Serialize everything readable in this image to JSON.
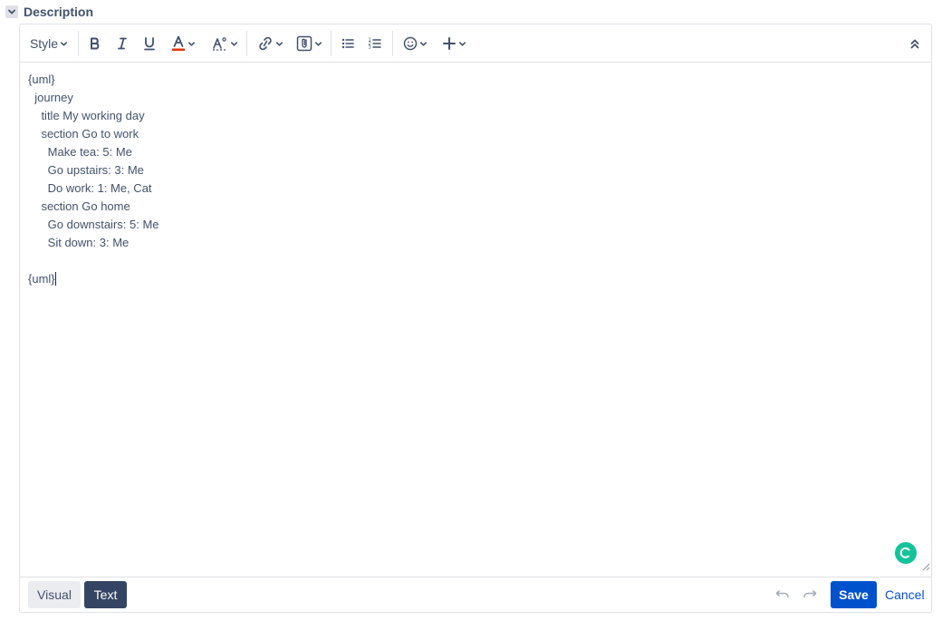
{
  "section": {
    "title": "Description",
    "toggle_icon": "chevron-down-icon"
  },
  "toolbar": {
    "style_label": "Style",
    "buttons": [
      {
        "name": "bold",
        "icon": "bold-icon"
      },
      {
        "name": "italic",
        "icon": "italic-icon"
      },
      {
        "name": "underline",
        "icon": "underline-icon"
      },
      {
        "name": "text-color",
        "icon": "text-color-icon"
      },
      {
        "name": "more-formatting",
        "icon": "text-style-icon"
      },
      {
        "name": "link",
        "icon": "link-icon"
      },
      {
        "name": "attachment",
        "icon": "attachment-icon"
      },
      {
        "name": "bullet-list",
        "icon": "bullet-list-icon"
      },
      {
        "name": "numbered-list",
        "icon": "numbered-list-icon"
      },
      {
        "name": "emoji",
        "icon": "emoji-icon"
      },
      {
        "name": "insert-more",
        "icon": "plus-icon"
      },
      {
        "name": "collapse-toolbar",
        "icon": "double-chevron-up-icon"
      }
    ],
    "colors": {
      "text_color_bar": "#de350b"
    }
  },
  "editor": {
    "content": "{uml}\n  journey\n    title My working day\n    section Go to work\n      Make tea: 5: Me\n      Go upstairs: 3: Me\n      Do work: 1: Me, Cat\n    section Go home\n      Go downstairs: 5: Me\n      Sit down: 3: Me\n\n{uml}"
  },
  "footer": {
    "mode_visual": "Visual",
    "mode_text": "Text",
    "active_mode": "Text",
    "save_label": "Save",
    "cancel_label": "Cancel"
  },
  "colors": {
    "primary": "#0052cc",
    "active_tab": "#344563",
    "grammarly": "#15c39a"
  }
}
